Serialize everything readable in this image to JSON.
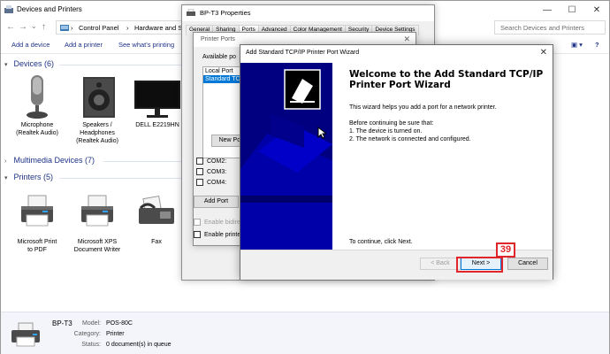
{
  "devices_window": {
    "title": "Devices and Printers",
    "breadcrumb": [
      "Control Panel",
      "Hardware and So"
    ],
    "search_placeholder": "Search Devices and Printers",
    "toolbar": [
      "Add a device",
      "Add a printer",
      "See what's printing"
    ],
    "groups": [
      {
        "label": "Devices (6)"
      },
      {
        "label": "Multimedia Devices (7)"
      },
      {
        "label": "Printers (5)"
      }
    ],
    "devices": [
      {
        "label": "Microphone\n(Realtek Audio)",
        "icon": "microphone-icon"
      },
      {
        "label": "Speakers /\nHeadphones\n(Realtek Audio)",
        "icon": "speaker-icon"
      },
      {
        "label": "DELL E2219HN",
        "icon": "monitor-icon"
      }
    ],
    "printers": [
      {
        "label": "Microsoft Print\nto PDF",
        "icon": "printer-icon"
      },
      {
        "label": "Microsoft XPS\nDocument Writer",
        "icon": "printer-icon"
      },
      {
        "label": "Fax",
        "icon": "fax-icon"
      }
    ],
    "status": {
      "name": "BP-T3",
      "model_label": "Model:",
      "model": "POS-80C",
      "category_label": "Category:",
      "category": "Printer",
      "status_label": "Status:",
      "status": "0 document(s) in queue"
    }
  },
  "properties_window": {
    "title": "BP-T3 Properties",
    "tabs": [
      "General",
      "Sharing",
      "Ports",
      "Advanced",
      "Color Management",
      "Security",
      "Device Settings"
    ],
    "active_tab": "Ports"
  },
  "printer_ports": {
    "title": "Printer Ports",
    "available_label": "Available po",
    "ports": [
      "Local Port",
      "Standard TC"
    ],
    "selected_port": "Standard TC",
    "new_port_button": "New Port",
    "com_ports": [
      "COM2:",
      "COM3:",
      "COM4:"
    ],
    "add_port_button": "Add Port",
    "enable_bidi": "Enable bidire",
    "enable_pooling": "Enable printe"
  },
  "wizard": {
    "title": "Add Standard TCP/IP Printer Port Wizard",
    "heading": "Welcome to the Add Standard TCP/IP Printer Port Wizard",
    "intro": "This wizard helps you add a port for a network printer.",
    "before_label": "Before continuing be sure that:",
    "checklist": [
      "1.  The device is turned on.",
      "2.  The network is connected and configured."
    ],
    "continue_text": "To continue, click Next.",
    "buttons": {
      "back": "< Back",
      "next": "Next >",
      "cancel": "Cancel"
    }
  },
  "annotation": {
    "step_number": "39",
    "color": "#e0262b"
  },
  "colors": {
    "wizard_sidebar": "#000080",
    "link_blue": "#1e3287",
    "selection": "#0078d7"
  }
}
